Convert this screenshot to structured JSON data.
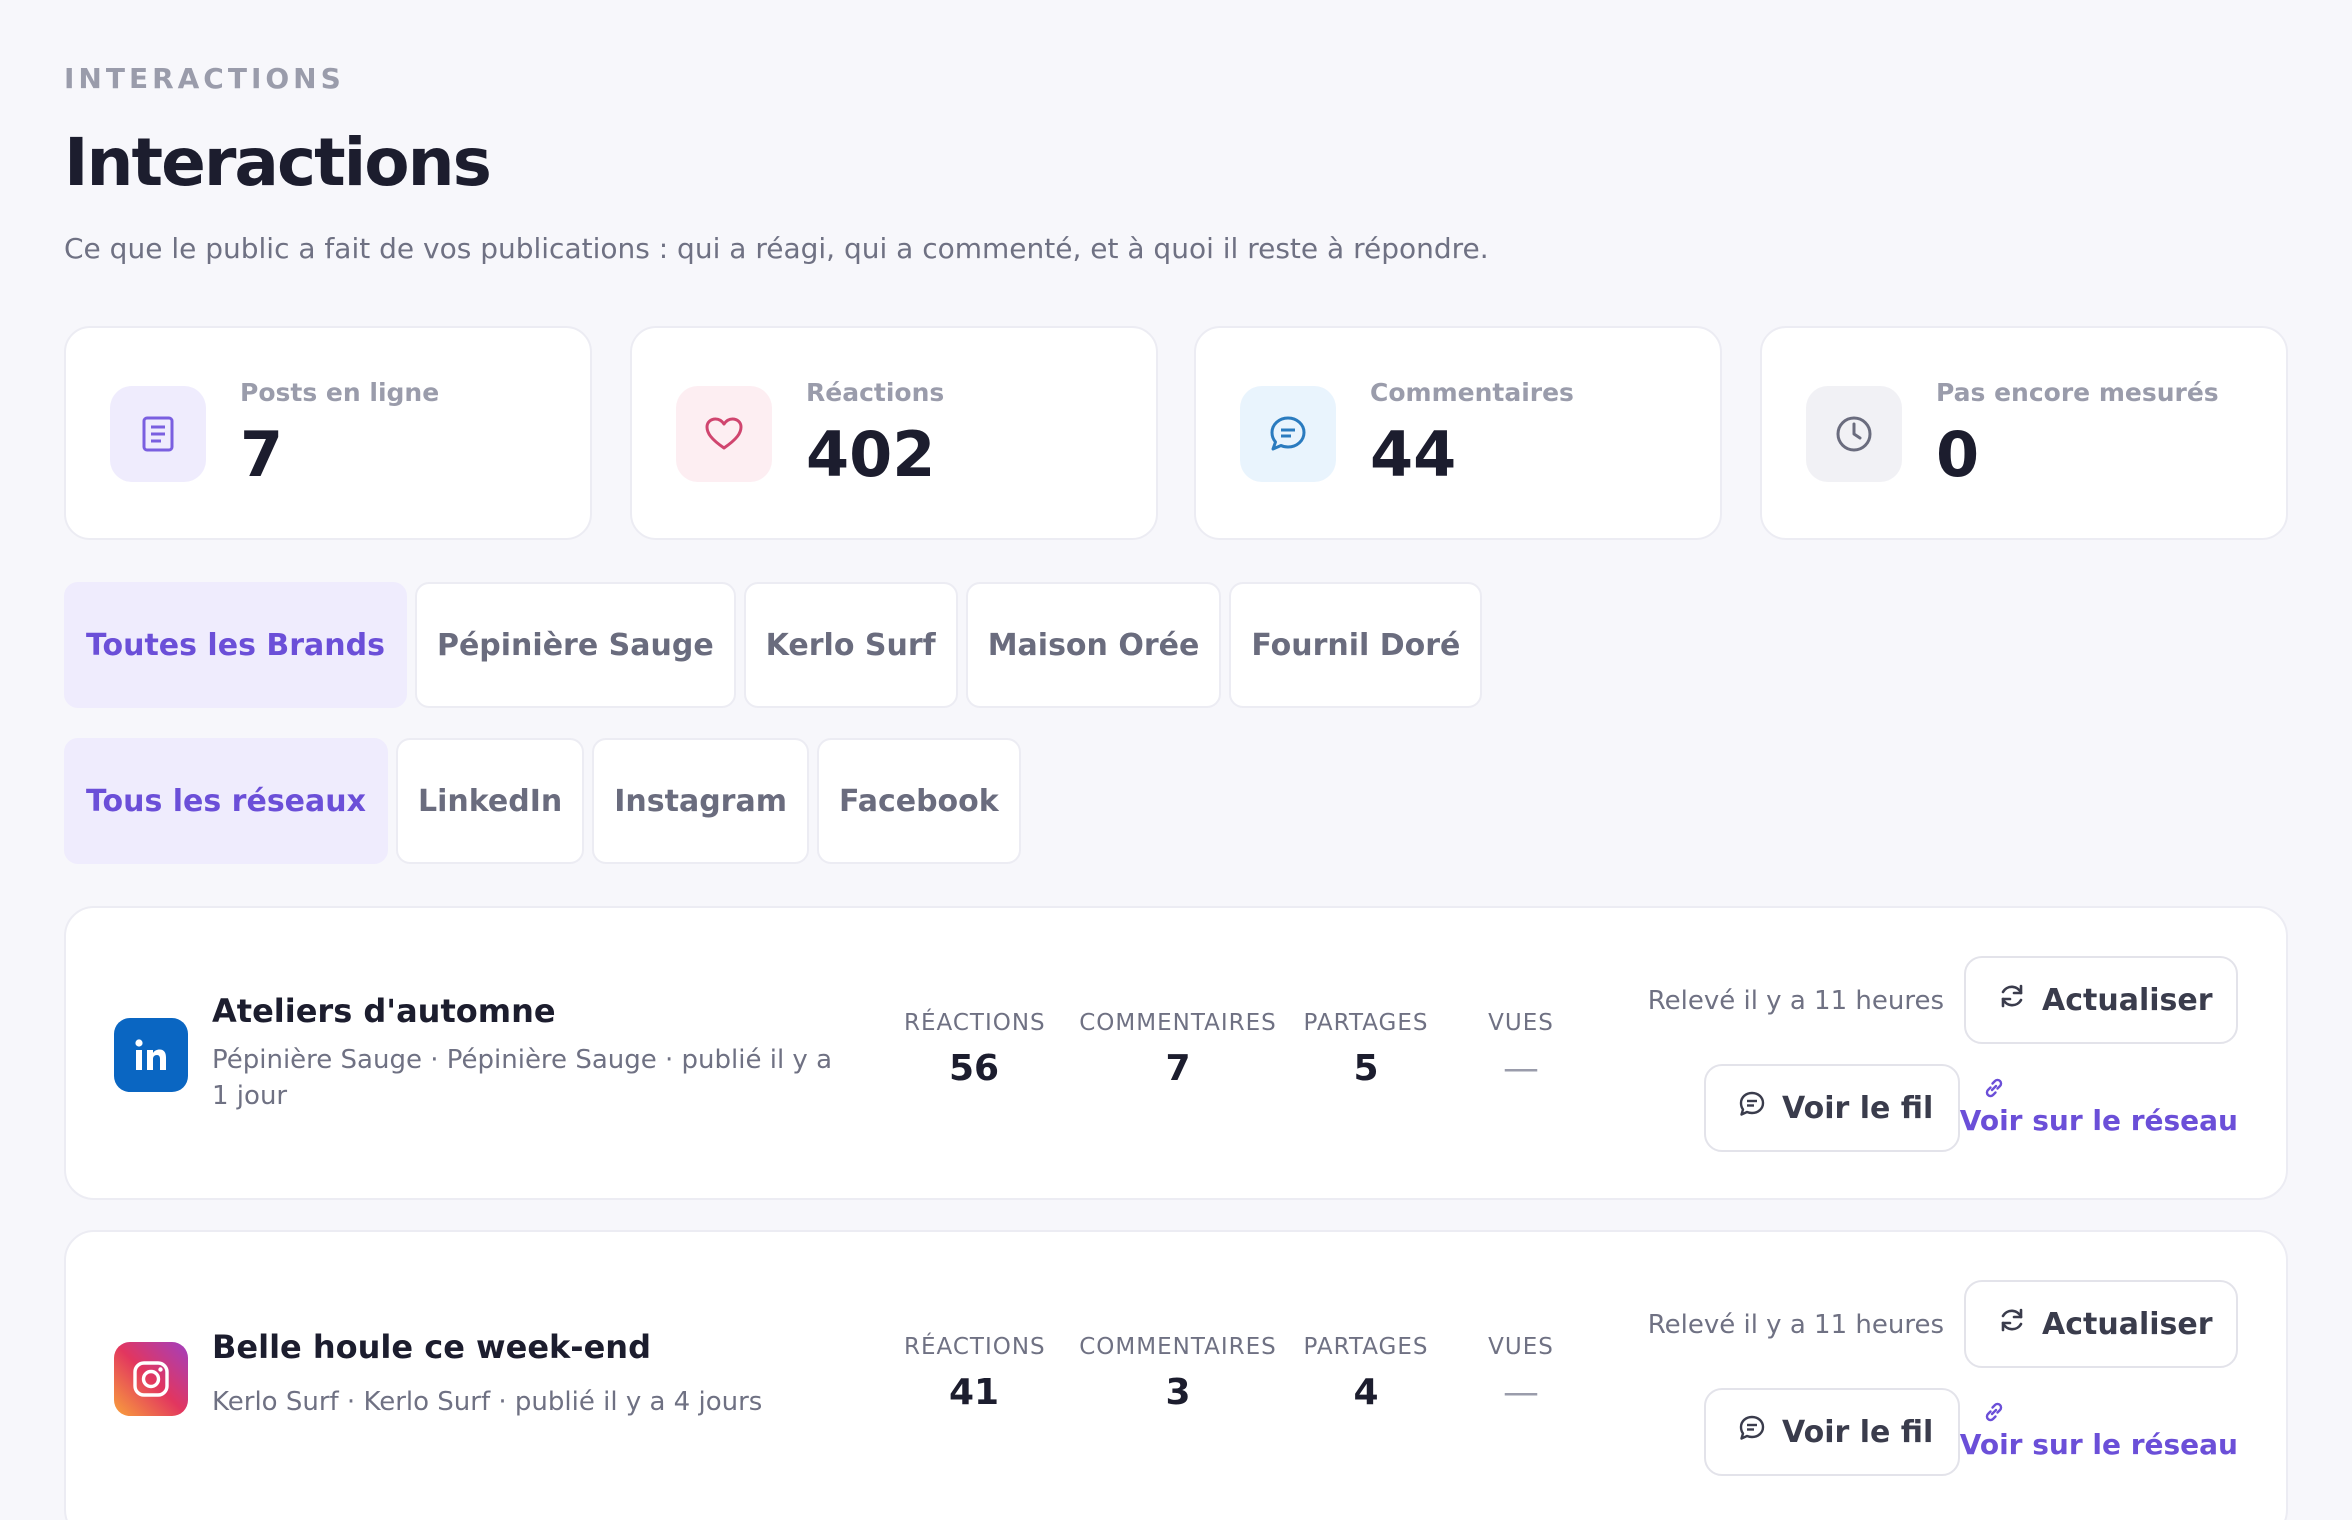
{
  "header": {
    "eyebrow": "INTERACTIONS",
    "title": "Interactions",
    "subtitle": "Ce que le public a fait de vos publications : qui a réagi, qui a commenté, et à quoi il reste à répondre."
  },
  "stats": [
    {
      "label": "Posts en ligne",
      "value": "7",
      "icon": "document-icon",
      "color": "#7a5fe0",
      "bg": "#efecfd"
    },
    {
      "label": "Réactions",
      "value": "402",
      "icon": "heart-icon",
      "color": "#d0456f",
      "bg": "#fdeef2"
    },
    {
      "label": "Commentaires",
      "value": "44",
      "icon": "comment-icon",
      "color": "#2a7bbf",
      "bg": "#e9f4fd"
    },
    {
      "label": "Pas encore mesurés",
      "value": "0",
      "icon": "clock-icon",
      "color": "#6a6c7e",
      "bg": "#f1f1f5"
    }
  ],
  "brand_filters": {
    "items": [
      "Toutes les Brands",
      "Pépinière Sauge",
      "Kerlo Surf",
      "Maison Orée",
      "Fournil Doré"
    ],
    "active": "Toutes les Brands"
  },
  "network_filters": {
    "items": [
      "Tous les réseaux",
      "LinkedIn",
      "Instagram",
      "Facebook"
    ],
    "active": "Tous les réseaux"
  },
  "metric_labels": {
    "reactions": "RÉACTIONS",
    "comments": "COMMENTAIRES",
    "shares": "PARTAGES",
    "views": "VUES"
  },
  "posts": [
    {
      "network": "linkedin",
      "network_icon": "linkedin-icon",
      "title": "Ateliers d'automne",
      "meta": "Pépinière Sauge · Pépinière Sauge · publié il y a 1 jour",
      "reactions": "56",
      "comments": "7",
      "shares": "5",
      "views": "—",
      "released": "Relevé il y a 11 heures",
      "refresh_label": "Actualiser",
      "thread_label": "Voir le fil",
      "link_label": "Voir sur le réseau"
    },
    {
      "network": "instagram",
      "network_icon": "instagram-icon",
      "title": "Belle houle ce week-end",
      "meta": "Kerlo Surf · Kerlo Surf · publié il y a 4 jours",
      "reactions": "41",
      "comments": "3",
      "shares": "4",
      "views": "—",
      "released": "Relevé il y a 11 heures",
      "refresh_label": "Actualiser",
      "thread_label": "Voir le fil",
      "link_label": "Voir sur le réseau"
    }
  ],
  "colors": {
    "accent": "#6b4fd8",
    "accent_bg": "#efecfd",
    "linkedin": "#0a66c2",
    "background": "#f7f7fb"
  }
}
